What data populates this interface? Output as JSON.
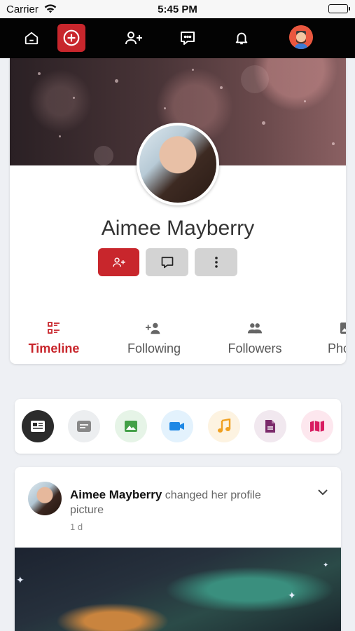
{
  "status_bar": {
    "carrier": "Carrier",
    "time": "5:45 PM"
  },
  "nav": {
    "items": [
      "home-icon",
      "add-post-icon",
      "add-friend-icon",
      "messages-icon",
      "notifications-icon",
      "user-avatar"
    ],
    "accent_color": "#c8262c"
  },
  "profile": {
    "name": "Aimee Mayberry",
    "actions": [
      "add-friend-icon",
      "message-icon",
      "more-icon"
    ]
  },
  "tabs": [
    {
      "label": "Timeline",
      "icon": "timeline-icon",
      "active": true
    },
    {
      "label": "Following",
      "icon": "following-icon",
      "active": false
    },
    {
      "label": "Followers",
      "icon": "followers-icon",
      "active": false
    },
    {
      "label": "Pho",
      "icon": "photos-icon",
      "active": false
    }
  ],
  "post_types": [
    "article-icon",
    "text-icon",
    "image-icon",
    "video-icon",
    "music-icon",
    "file-icon",
    "map-icon"
  ],
  "post": {
    "author": "Aimee Mayberry",
    "action": "changed her profile picture",
    "time": "1 d"
  }
}
